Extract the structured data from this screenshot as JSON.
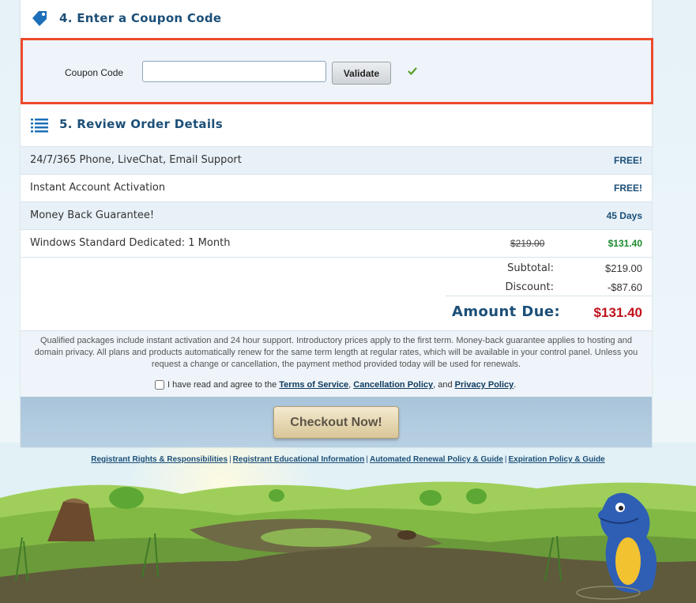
{
  "coupon": {
    "heading": "4. Enter a Coupon Code",
    "label": "Coupon Code",
    "input_value": "",
    "validate_label": "Validate",
    "status_icon": "check-icon"
  },
  "review": {
    "heading": "5. Review Order Details",
    "rows": [
      {
        "label": "24/7/365 Phone, LiveChat, Email Support",
        "value": "FREE!"
      },
      {
        "label": "Instant Account Activation",
        "value": "FREE!"
      },
      {
        "label": "Money Back Guarantee!",
        "value": "45 Days"
      },
      {
        "label": "Windows Standard Dedicated: 1 Month",
        "old_price": "$219.00",
        "value": "$131.40"
      }
    ],
    "subtotal_label": "Subtotal:",
    "subtotal_value": "$219.00",
    "discount_label": "Discount:",
    "discount_value": "-$87.60",
    "amount_due_label": "Amount Due:",
    "amount_due_value": "$131.40"
  },
  "legal": {
    "text": "Qualified packages include instant activation and 24 hour support. Introductory prices apply to the first term. Money-back guarantee applies to hosting and domain privacy. All plans and products automatically renew for the same term length at regular rates, which will be available in your control panel. Unless you request a change or cancellation, the payment method provided today will be used for renewals.",
    "agree_prefix": "I have read and agree to the",
    "tos": "Terms of Service",
    "comma": ",",
    "cancellation": "Cancellation Policy",
    "and": ", and",
    "privacy": "Privacy Policy",
    "period": "."
  },
  "checkout": {
    "label": "Checkout Now!"
  },
  "footer": {
    "links": [
      "Registrant Rights & Responsibilities",
      "Registrant Educational Information",
      "Automated Renewal Policy & Guide",
      "Expiration Policy & Guide"
    ],
    "separator": "|"
  },
  "colors": {
    "heading_blue": "#1c4f78",
    "highlight_border": "#ee4a2c",
    "discount_green": "#1c8a2e",
    "amount_due_red": "#c0131e"
  }
}
